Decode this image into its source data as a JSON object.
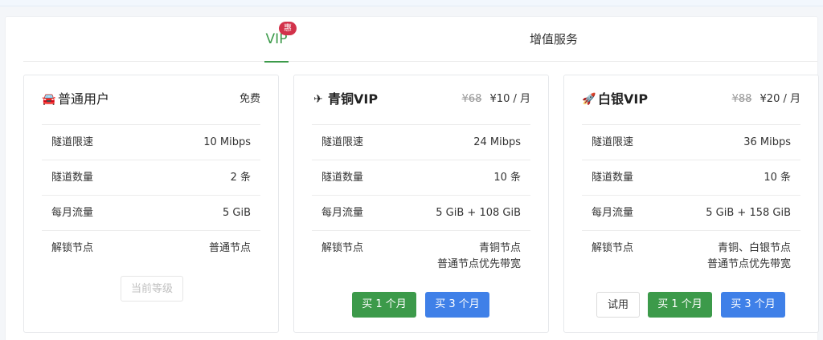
{
  "tabs": {
    "vip_label": "VIP",
    "vip_badge": "惠",
    "service_label": "增值服务"
  },
  "colors": {
    "accent_green": "#3c9a4a",
    "accent_blue": "#3f80e8",
    "badge_red": "#d2324a"
  },
  "plans": [
    {
      "icon": "car-icon",
      "icon_glyph": "🚘",
      "name": "普通用户",
      "old_price": "",
      "price": "免费",
      "rows": [
        {
          "key": "隧道限速",
          "value": "10 Mibps"
        },
        {
          "key": "隧道数量",
          "value": "2 条"
        },
        {
          "key": "每月流量",
          "value": "5 GiB"
        },
        {
          "key": "解锁节点",
          "value": "普通节点",
          "value2": ""
        }
      ],
      "buttons": {
        "current": "当前等级"
      }
    },
    {
      "icon": "plane-icon",
      "icon_glyph": "✈",
      "name": "青铜VIP",
      "old_price": "¥68",
      "price": "¥10 / 月",
      "rows": [
        {
          "key": "隧道限速",
          "value": "24 Mibps"
        },
        {
          "key": "隧道数量",
          "value": "10 条"
        },
        {
          "key": "每月流量",
          "value": "5 GiB + 108 GiB"
        },
        {
          "key": "解锁节点",
          "value": "青铜节点",
          "value2": "普通节点优先带宽"
        }
      ],
      "buttons": {
        "buy1": "买 1 个月",
        "buy3": "买 3 个月"
      }
    },
    {
      "icon": "rocket-icon",
      "icon_glyph": "🚀",
      "name": "白银VIP",
      "old_price": "¥88",
      "price": "¥20 / 月",
      "rows": [
        {
          "key": "隧道限速",
          "value": "36 Mibps"
        },
        {
          "key": "隧道数量",
          "value": "10 条"
        },
        {
          "key": "每月流量",
          "value": "5 GiB + 158 GiB"
        },
        {
          "key": "解锁节点",
          "value": "青铜、白银节点",
          "value2": "普通节点优先带宽"
        }
      ],
      "buttons": {
        "trial": "试用",
        "buy1": "买 1 个月",
        "buy3": "买 3 个月"
      }
    }
  ]
}
